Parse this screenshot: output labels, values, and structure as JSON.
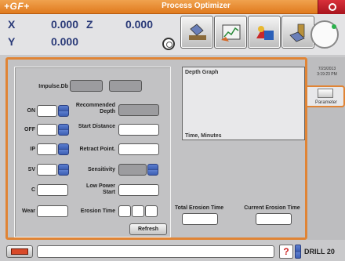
{
  "app": {
    "brand": "+GF+",
    "title": "Process Optimizer"
  },
  "coords": {
    "x_label": "X",
    "x_value": "0.000",
    "y_label": "Y",
    "y_value": "0.000",
    "z_label": "Z",
    "z_value": "0.000"
  },
  "toolbar": {
    "icons": [
      "probe-tool-icon",
      "graph-tool-icon",
      "shapes-tool-icon",
      "electrode-tool-icon"
    ]
  },
  "sidebar": {
    "date": "7/23/2013",
    "time": "3:19:23 PM",
    "param_label": "Parameter"
  },
  "form": {
    "impulse_label": "Impulse.Db",
    "on_label": "ON",
    "off_label": "OFF",
    "ip_label": "IP",
    "sv_label": "SV",
    "c_label": "C",
    "wear_label": "Wear",
    "rec_depth_label": "Recommended Depth",
    "start_distance_label": "Start Distance",
    "retract_label": "Retract Point.",
    "sensitivity_label": "Sensitivity",
    "low_power_label": "Low Power Start",
    "erosion_time_label": "Erosion Time"
  },
  "graph": {
    "title": "Depth Graph",
    "xlabel": "Time, Minutes"
  },
  "totals": {
    "total_label": "Total Erosion Time",
    "current_label": "Current Erosion Time"
  },
  "actions": {
    "refresh_label": "Refresh"
  },
  "status": {
    "help": "?",
    "mode": "DRILL 20"
  },
  "colors": {
    "accent": "#e08435",
    "axis_text": "#2a3a78",
    "spin": "#3d5fb3"
  }
}
